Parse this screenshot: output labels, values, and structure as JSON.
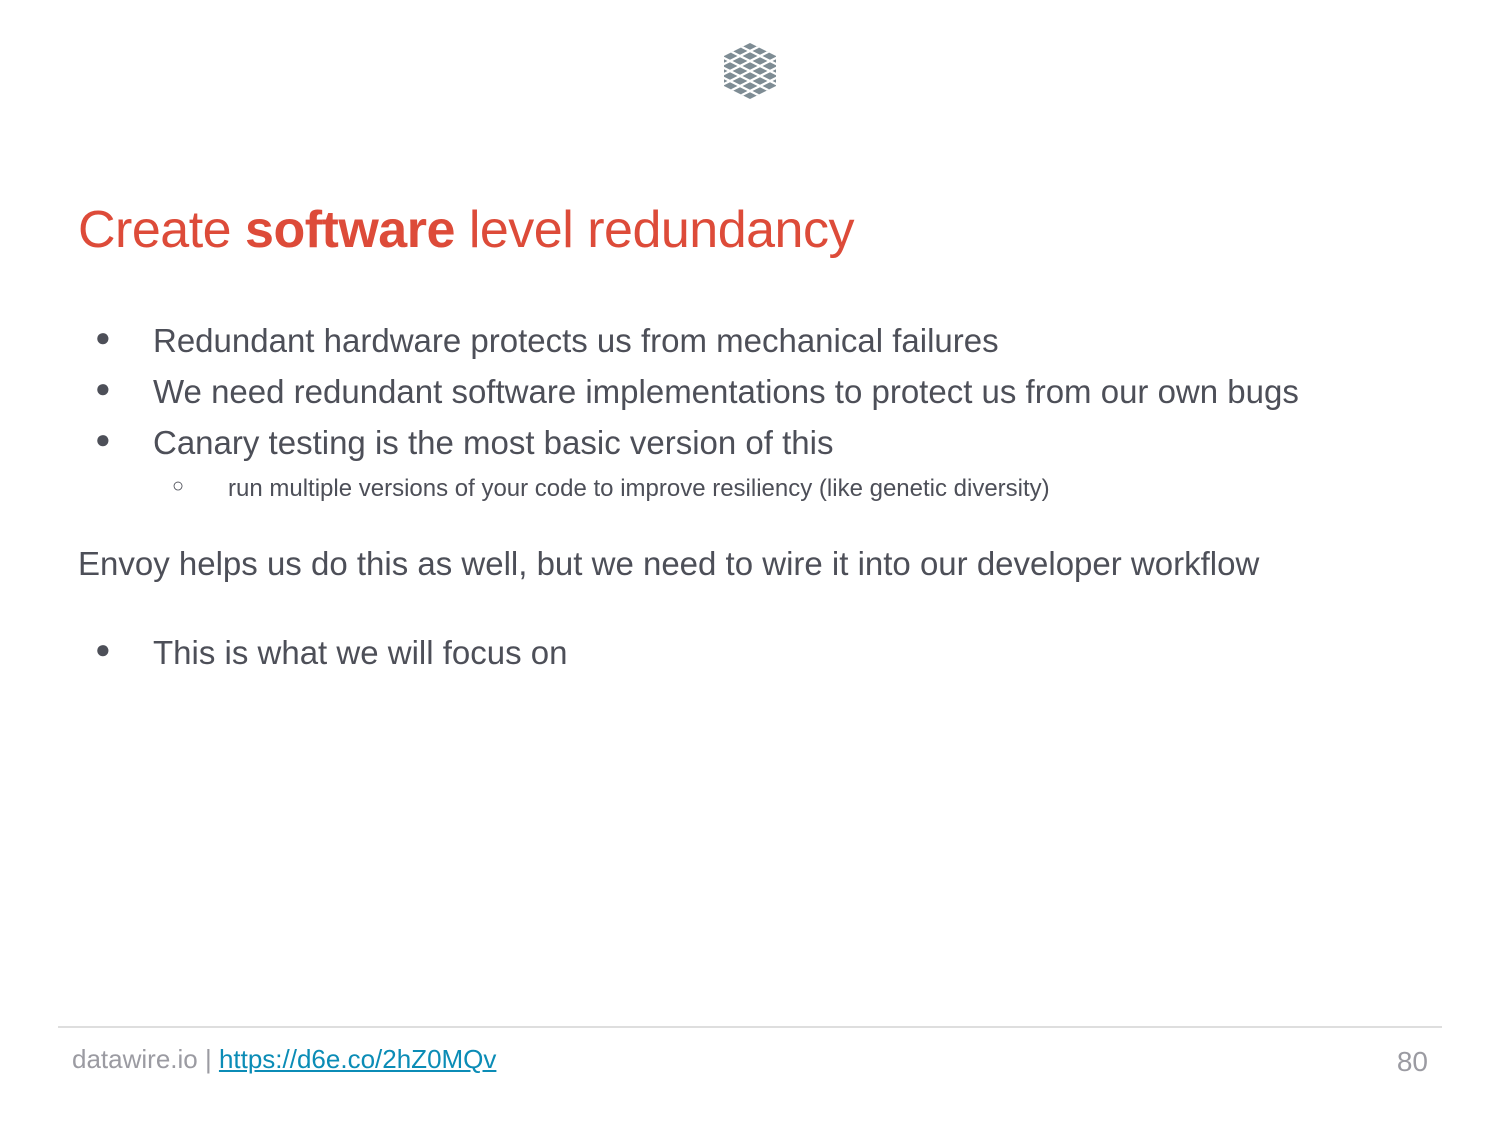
{
  "logo": {
    "icon": "datawire-lattice-logo-icon",
    "color": "#7e8c94"
  },
  "title": {
    "part1": "Create ",
    "bold": "software",
    "part2": " level redundancy",
    "color": "#dd4b39"
  },
  "bullets": [
    "Redundant hardware protects us from mechanical failures",
    "We need redundant software implementations to protect us from our own bugs",
    "Canary testing is the most basic version of this"
  ],
  "sub_bullets": [
    "run multiple versions of your code to improve resiliency (like genetic diversity)"
  ],
  "paragraph": "Envoy helps us do this as well, but we need to wire it into our developer workflow",
  "bullets2": [
    "This is what we will focus on"
  ],
  "footer": {
    "site": "datawire.io",
    "separator": " | ",
    "link": "https://d6e.co/2hZ0MQv",
    "link_color": "#0b8cb6",
    "page_number": "80"
  }
}
